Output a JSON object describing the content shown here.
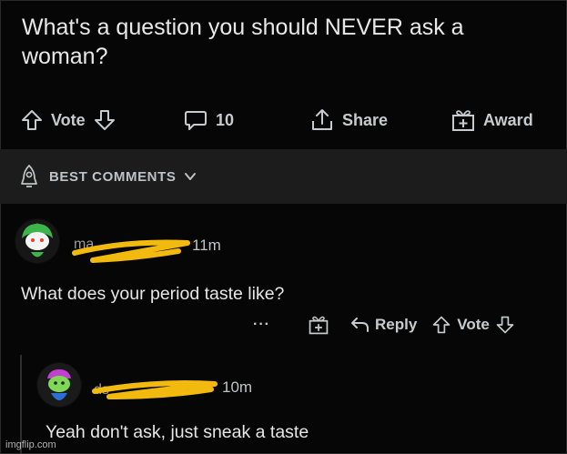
{
  "post": {
    "title": "What's a question you should NEVER ask a woman?",
    "vote_label": "Vote",
    "comment_count": "10",
    "share_label": "Share",
    "award_label": "Award"
  },
  "sort": {
    "label": "BEST COMMENTS"
  },
  "comments": [
    {
      "username_visible": "ma",
      "time": "11m",
      "text": "What does your period taste like?",
      "more_label": "···",
      "reply_label": "Reply",
      "vote_label": "Vote"
    },
    {
      "username_visible": "ds",
      "time": "10m",
      "text": "Yeah don't ask, just sneak a taste"
    }
  ],
  "watermark": "imgflip.com",
  "colors": {
    "background": "#060606",
    "sort_bar": "#1c1c1c",
    "text": "#e6e6e6",
    "muted": "#c8cbcd",
    "redaction": "#f2b90f"
  }
}
